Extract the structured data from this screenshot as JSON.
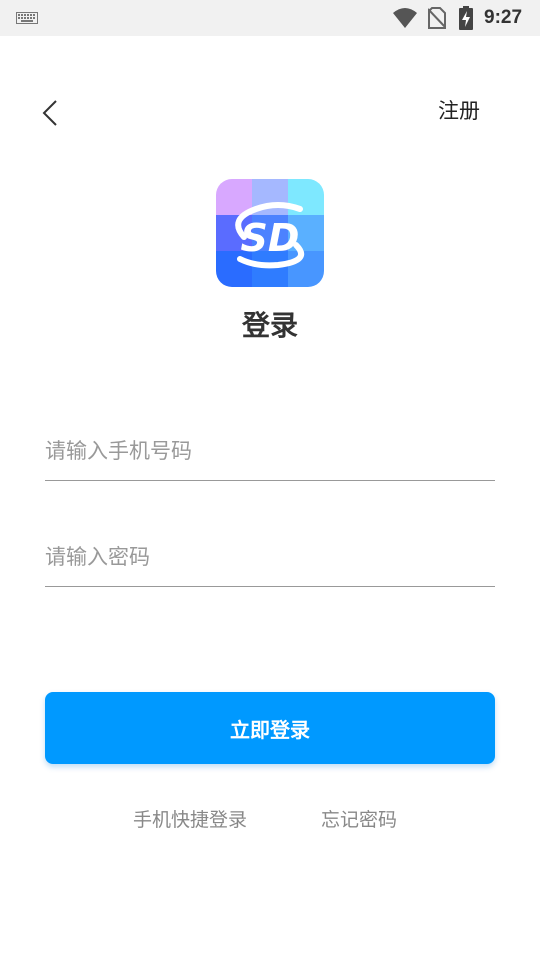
{
  "status_bar": {
    "time": "9:27",
    "icons": [
      "keyboard-icon",
      "wifi-icon",
      "no-sim-icon",
      "battery-charging-icon"
    ]
  },
  "header": {
    "back_icon": "chevron-left-icon",
    "register_label": "注册"
  },
  "logo": {
    "text": "SD",
    "colors": [
      "#d8a8ff",
      "#a5b8ff",
      "#7ee8ff",
      "#5a6cff",
      "#4c82ff",
      "#5ab0ff",
      "#2a6cff",
      "#2f7cff",
      "#4896ff"
    ]
  },
  "title": "登录",
  "form": {
    "phone_placeholder": "请输入手机号码",
    "password_placeholder": "请输入密码",
    "submit_label": "立即登录"
  },
  "links": {
    "quick_login": "手机快捷登录",
    "forgot_password": "忘记密码"
  },
  "colors": {
    "accent": "#0099ff",
    "status_bar_bg": "#f1f1f1",
    "placeholder": "#999999",
    "link": "#888888"
  }
}
